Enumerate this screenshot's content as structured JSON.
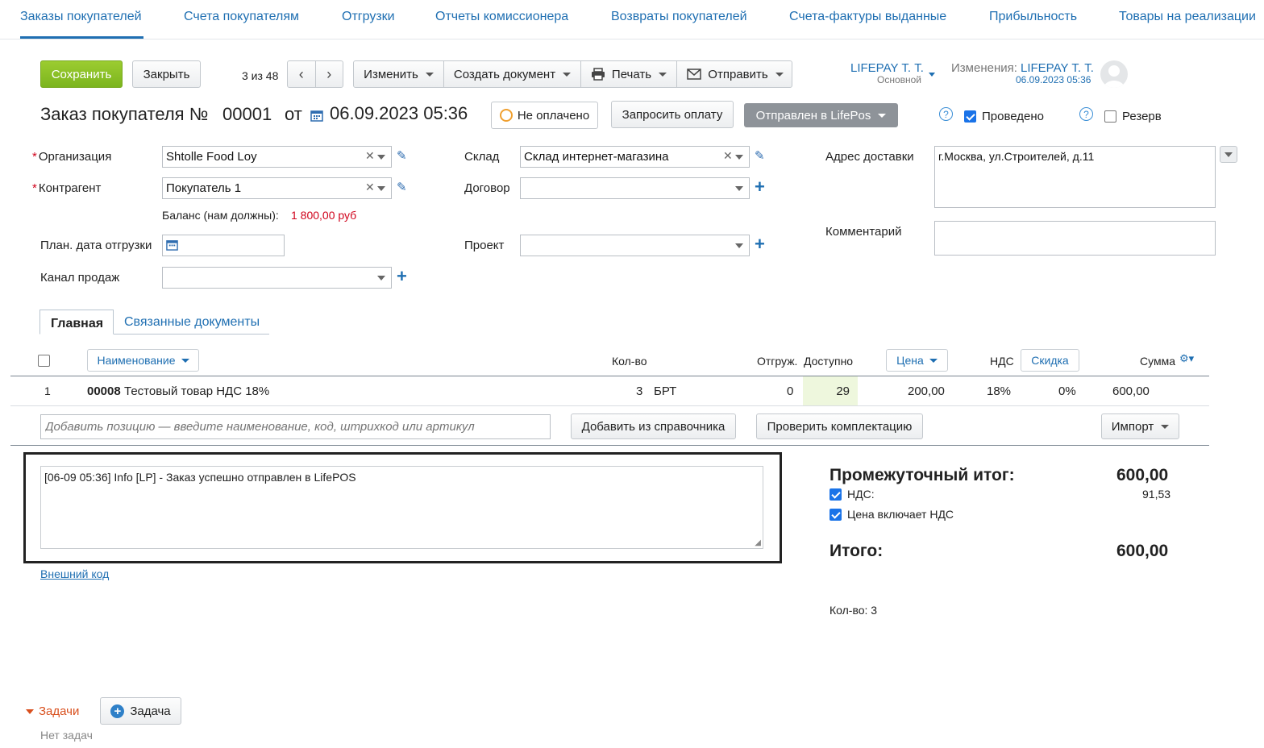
{
  "nav": {
    "tabs": [
      "Заказы покупателей",
      "Счета покупателям",
      "Отгрузки",
      "Отчеты комиссионера",
      "Возвраты покупателей",
      "Счета-фактуры выданные",
      "Прибыльность",
      "Товары на реализации"
    ]
  },
  "toolbar": {
    "save": "Сохранить",
    "close": "Закрыть",
    "counter": "3 из 48",
    "edit": "Изменить",
    "create_doc": "Создать документ",
    "print": "Печать",
    "send": "Отправить"
  },
  "user": {
    "name": "LIFEPAY Т. Т.",
    "role": "Основной",
    "changes_label": "Изменения:",
    "changes_user": "LIFEPAY Т. Т.",
    "changes_date": "06.09.2023 05:36"
  },
  "doc": {
    "title_prefix": "Заказ покупателя №",
    "number": "00001",
    "from": "от",
    "datetime": "06.09.2023 05:36",
    "payment_status": "Не оплачено",
    "request_payment": "Запросить оплату",
    "state": "Отправлен в LifePos",
    "posted_label": "Проведено",
    "reserve_label": "Резерв",
    "posted": true,
    "reserve": false
  },
  "form": {
    "org_label": "Организация",
    "org_value": "Shtolle Food Loy",
    "counterparty_label": "Контрагент",
    "counterparty_value": "Покупатель 1",
    "balance_label": "Баланс (нам должны):",
    "balance_value": "1 800,00 руб",
    "ship_date_label": "План. дата отгрузки",
    "channel_label": "Канал продаж",
    "warehouse_label": "Склад",
    "warehouse_value": "Склад интернет-магазина",
    "contract_label": "Договор",
    "project_label": "Проект",
    "address_label": "Адрес доставки",
    "address_value": "г.Москва, ул.Строителей, д.11",
    "comment_label": "Комментарий"
  },
  "tabs": {
    "main": "Главная",
    "related": "Связанные документы"
  },
  "table": {
    "headers": {
      "name": "Наименование",
      "qty": "Кол-во",
      "shipped": "Отгруж.",
      "available": "Доступно",
      "price": "Цена",
      "vat": "НДС",
      "discount": "Скидка",
      "sum": "Сумма"
    },
    "rows": [
      {
        "n": "1",
        "code": "00008",
        "name": "Тестовый товар НДС 18%",
        "qty": "3",
        "unit": "БРТ",
        "shipped": "0",
        "available": "29",
        "price": "200,00",
        "vat": "18%",
        "discount": "0%",
        "sum": "600,00"
      }
    ],
    "add_placeholder": "Добавить позицию — введите наименование, код, штрихкод или артикул",
    "add_from_catalog": "Добавить из справочника",
    "check_kit": "Проверить комплектацию",
    "import": "Импорт"
  },
  "log": {
    "text": "[06-09 05:36] Info [LP] - Заказ успешно отправлен в LifePOS",
    "external_code": "Внешний код"
  },
  "totals": {
    "subtotal_label": "Промежуточный итог:",
    "subtotal_value": "600,00",
    "vat_label": "НДС:",
    "vat_value": "91,53",
    "price_incl_vat_label": "Цена включает НДС",
    "total_label": "Итого:",
    "total_value": "600,00",
    "qty_label": "Кол-во: 3"
  },
  "tasks": {
    "label": "Задачи",
    "add": "Задача",
    "empty": "Нет задач"
  },
  "colors": {
    "accent": "#1f6fb2",
    "green": "#8bc34a",
    "available_bg": "#eef7dd",
    "negative": "#d0021b"
  }
}
